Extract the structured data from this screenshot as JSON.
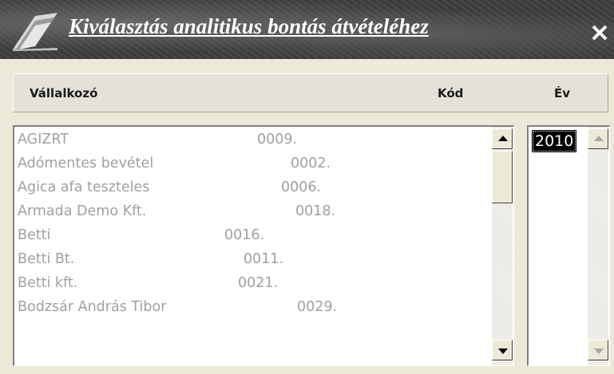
{
  "window": {
    "title": "Kiválasztás analitikus bontás átvételéhez",
    "close_glyph": "✕"
  },
  "header": {
    "col_contractor": "Vállalkozó",
    "col_code": "Kód",
    "col_year": "Év"
  },
  "rows": [
    {
      "name": "AGIZRT",
      "code": "0009."
    },
    {
      "name": "Adómentes bevétel",
      "code": "0002."
    },
    {
      "name": "Agica afa teszteles",
      "code": "0006."
    },
    {
      "name": "Armada Demo Kft.",
      "code": "0018."
    },
    {
      "name": "Betti",
      "code": "0016."
    },
    {
      "name": "Betti Bt.",
      "code": "0011."
    },
    {
      "name": "Betti kft.",
      "code": "0021."
    },
    {
      "name": "Bodzsár András Tibor",
      "code": "0029."
    }
  ],
  "years": [
    "2010"
  ],
  "colors": {
    "row_text": "#a0a0a0",
    "selected_bg": "#000000",
    "selected_fg": "#ffffff"
  }
}
